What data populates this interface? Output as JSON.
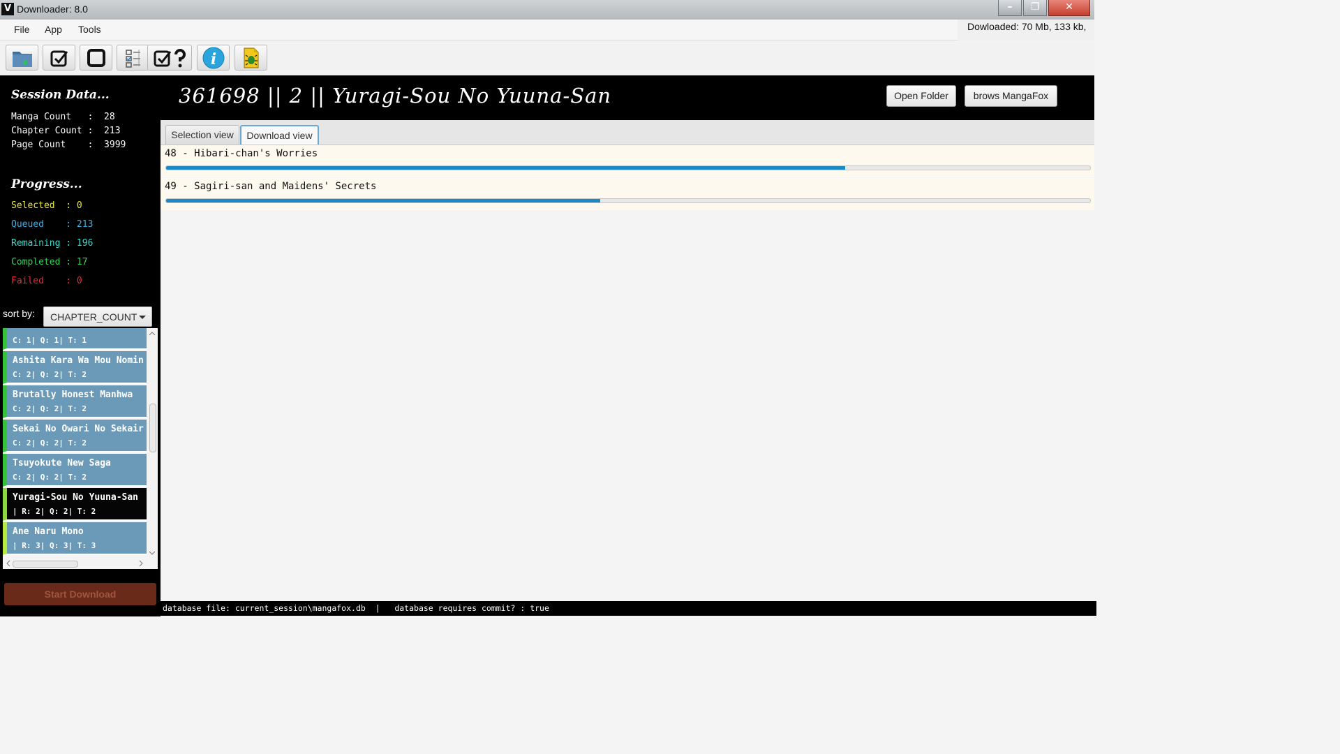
{
  "window": {
    "title": "Downloader: 8.0"
  },
  "menu": [
    "File",
    "App",
    "Tools"
  ],
  "downloaded_text": "Dowloaded: 70 Mb, 133 kb,",
  "toolbar": [
    "folder-download-icon",
    "check-all-icon",
    "stop-icon",
    "checklist-icon",
    "check-question-icon",
    "info-icon",
    "bug-report-icon"
  ],
  "session": {
    "heading": "Session Data...",
    "lines": [
      {
        "label": "Manga Count",
        "value": "28",
        "text": "Manga Count   :  28"
      },
      {
        "label": "Chapter Count",
        "value": "213",
        "text": "Chapter Count :  213"
      },
      {
        "label": "Page Count",
        "value": "3999",
        "text": "Page Count    :  3999"
      }
    ]
  },
  "progress": {
    "heading": "Progress...",
    "lines": [
      {
        "text": "Selected  : 0",
        "color": "#e8e83a"
      },
      {
        "text": "Queued    : 213",
        "color": "#3cb1e8"
      },
      {
        "text": "Remaining : 196",
        "color": "#2fe0d0"
      },
      {
        "text": "Completed : 17",
        "color": "#34d35a"
      },
      {
        "text": "Failed    : 0",
        "color": "#e02e3a"
      }
    ]
  },
  "sort": {
    "label": "sort by:",
    "value": "CHAPTER_COUNT"
  },
  "manga_list": [
    {
      "name": "",
      "stats": "C: 1| Q: 1| T: 1"
    },
    {
      "name": "Ashita Kara Wa Mou Nomin",
      "stats": "C: 2| Q: 2| T: 2"
    },
    {
      "name": "Brutally Honest Manhwa",
      "stats": "C: 2| Q: 2| T: 2"
    },
    {
      "name": "Sekai No Owari No Sekair",
      "stats": "C: 2| Q: 2| T: 2"
    },
    {
      "name": "Tsuyokute New Saga",
      "stats": "C: 2| Q: 2| T: 2"
    },
    {
      "name": "Yuragi-Sou No Yuuna-San",
      "stats": "| R: 2| Q: 2| T: 2"
    },
    {
      "name": "Ane Naru Mono",
      "stats": "| R: 3| Q: 3| T: 3"
    }
  ],
  "start_button": "Start Download",
  "header": {
    "title": "361698 || 2 || Yuragi-Sou No Yuuna-San",
    "open_folder": "Open Folder",
    "browse": "brows MangaFox"
  },
  "tabs": {
    "selection": "Selection view",
    "download": "Download view"
  },
  "downloads": [
    {
      "title": "48 - Hibari-chan's Worries",
      "progress": 0.735
    },
    {
      "title": "49 - Sagiri-san and Maidens' Secrets",
      "progress": 0.47
    }
  ],
  "status": "database file: current_session\\mangafox.db  |   database requires commit? : true"
}
